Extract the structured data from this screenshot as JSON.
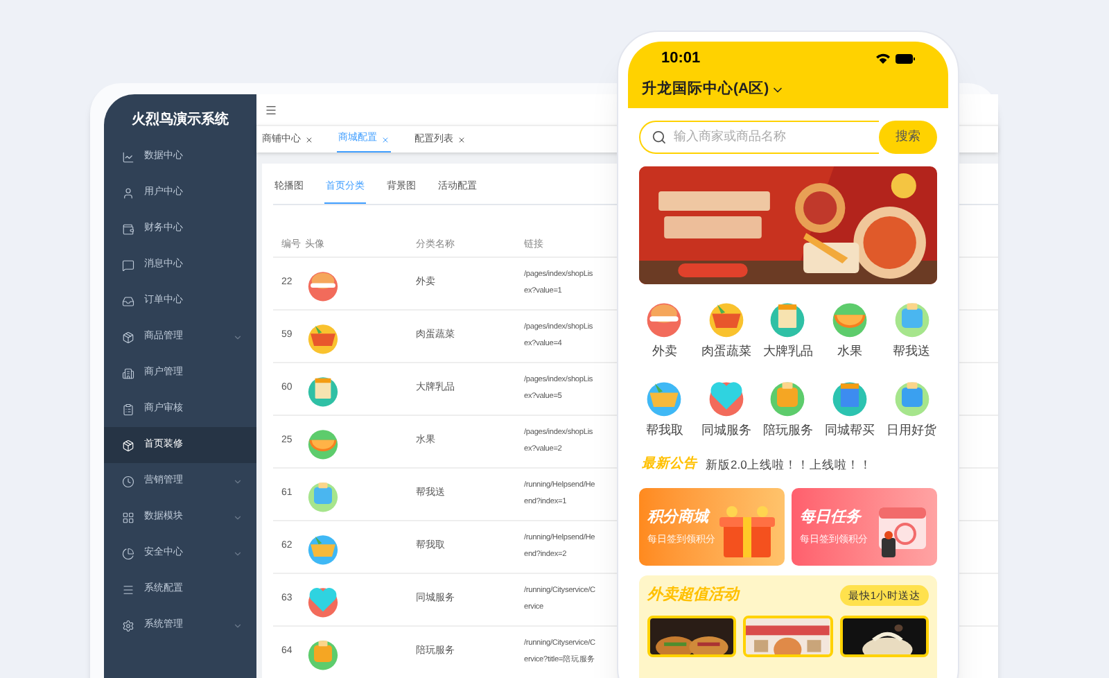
{
  "admin": {
    "brand": "火烈鸟演示系统",
    "sidebar": {
      "items": [
        {
          "label": "数据中心",
          "selected": false,
          "expandable": false
        },
        {
          "label": "用户中心",
          "selected": false,
          "expandable": false
        },
        {
          "label": "财务中心",
          "selected": false,
          "expandable": false
        },
        {
          "label": "消息中心",
          "selected": false,
          "expandable": false
        },
        {
          "label": "订单中心",
          "selected": false,
          "expandable": false
        },
        {
          "label": "商品管理",
          "selected": false,
          "expandable": true
        },
        {
          "label": "商户管理",
          "selected": false,
          "expandable": false
        },
        {
          "label": "商户审核",
          "selected": false,
          "expandable": false
        },
        {
          "label": "首页装修",
          "selected": true,
          "expandable": false
        },
        {
          "label": "营销管理",
          "selected": false,
          "expandable": true
        },
        {
          "label": "数据模块",
          "selected": false,
          "expandable": true
        },
        {
          "label": "安全中心",
          "selected": false,
          "expandable": true
        },
        {
          "label": "系统配置",
          "selected": false,
          "expandable": false
        },
        {
          "label": "系统管理",
          "selected": false,
          "expandable": true
        }
      ]
    },
    "page_tabs": [
      {
        "label": "商铺中心",
        "selected": false
      },
      {
        "label": "商城配置",
        "selected": true
      },
      {
        "label": "配置列表",
        "selected": false
      }
    ],
    "sub_tabs": [
      {
        "label": "轮播图",
        "selected": false
      },
      {
        "label": "首页分类",
        "selected": true
      },
      {
        "label": "背景图",
        "selected": false
      },
      {
        "label": "活动配置",
        "selected": false
      }
    ],
    "table": {
      "columns": [
        "编号",
        "头像",
        "分类名称",
        "链接"
      ],
      "rows": [
        {
          "id": "22",
          "name": "外卖",
          "link_lines": [
            "/pages/index/shopLis",
            "ex?value=1"
          ]
        },
        {
          "id": "59",
          "name": "肉蛋蔬菜",
          "link_lines": [
            "/pages/index/shopLis",
            "ex?value=4"
          ]
        },
        {
          "id": "60",
          "name": "大牌乳品",
          "link_lines": [
            "/pages/index/shopLis",
            "ex?value=5"
          ]
        },
        {
          "id": "25",
          "name": "水果",
          "link_lines": [
            "/pages/index/shopLis",
            "ex?value=2"
          ]
        },
        {
          "id": "61",
          "name": "帮我送",
          "link_lines": [
            "/running/Helpsend/He",
            "end?index=1"
          ]
        },
        {
          "id": "62",
          "name": "帮我取",
          "link_lines": [
            "/running/Helpsend/He",
            "end?index=2"
          ]
        },
        {
          "id": "63",
          "name": "同城服务",
          "link_lines": [
            "/running/Cityservice/C",
            "ervice"
          ]
        },
        {
          "id": "64",
          "name": "陪玩服务",
          "link_lines": [
            "/running/Cityservice/C",
            "ervice?title=陪玩服务"
          ]
        }
      ]
    }
  },
  "phone": {
    "time": "10:01",
    "location": "升龙国际中心(A区)",
    "search": {
      "placeholder": "输入商家或商品名称",
      "button": "搜索"
    },
    "categories": [
      "外卖",
      "肉蛋蔬菜",
      "大牌乳品",
      "水果",
      "帮我送",
      "帮我取",
      "同城服务",
      "陪玩服务",
      "同城帮买",
      "日用好货"
    ],
    "notice": {
      "label": "最新公告",
      "text": "新版2.0上线啦！！上线啦！！"
    },
    "promo_cards": [
      {
        "title": "积分商城",
        "subtitle": "每日签到领积分"
      },
      {
        "title": "每日任务",
        "subtitle": "每日签到领积分"
      }
    ],
    "activity": {
      "title": "外卖超值活动",
      "badge": "最快1小时送达"
    }
  }
}
